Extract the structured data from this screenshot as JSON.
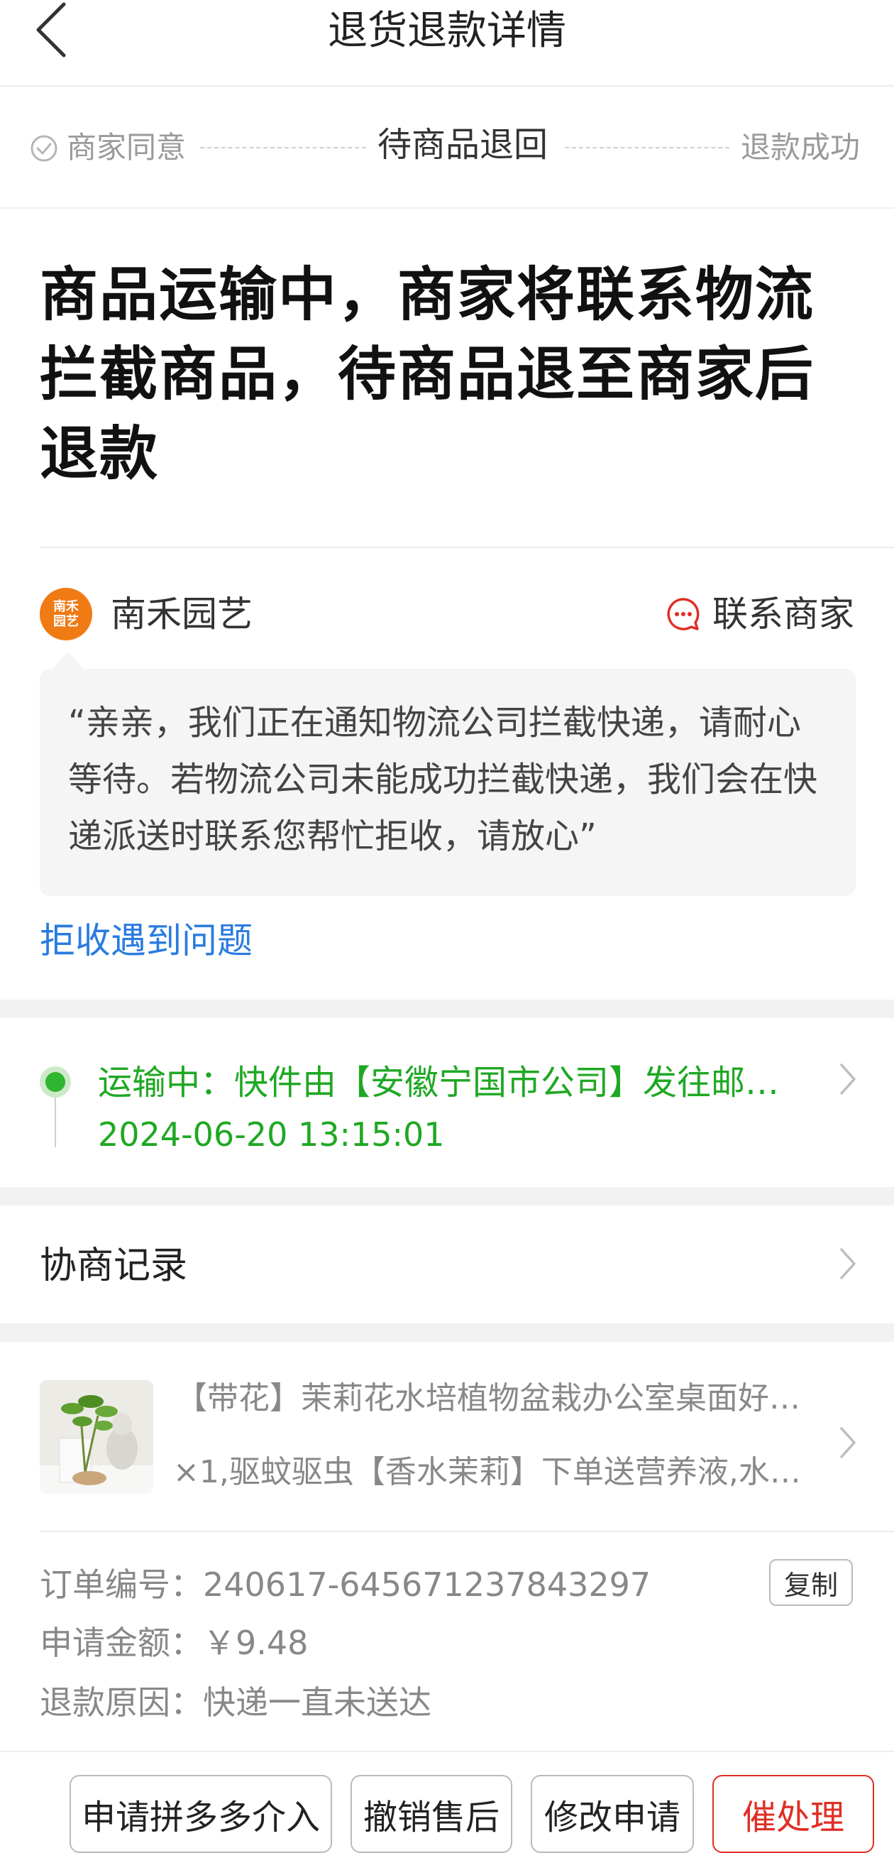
{
  "header": {
    "title": "退货退款详情"
  },
  "steps": [
    {
      "label": "商家同意",
      "state": "done"
    },
    {
      "label": "待商品退回",
      "state": "active"
    },
    {
      "label": "退款成功",
      "state": "pending"
    }
  ],
  "headline": "商品运输中，商家将联系物流拦截商品，待商品退至商家后退款",
  "shop": {
    "logo_text": "南禾\n园艺",
    "name": "南禾园艺",
    "contact_label": "联系商家"
  },
  "message": "“亲亲，我们正在通知物流公司拦截快递，请耐心等待。若物流公司未能成功拦截快递，我们会在快递派送时联系您帮忙拒收，请放心”",
  "reject_issue_link": "拒收遇到问题",
  "logistics": {
    "status": "运输中：快件由【安徽宁国市公司】发往邮…",
    "time": "2024-06-20 13:15:01"
  },
  "negotiation": {
    "label": "协商记录"
  },
  "product": {
    "title": "【带花】茉莉花水培植物盆栽办公室桌面好…",
    "spec": "×1,驱蚊驱虫【香水茉莉】下单送营养液,水养…"
  },
  "order": {
    "number_label": "订单编号：",
    "number": "240617-645671237843297",
    "copy_label": "复制",
    "amount_label": "申请金额：",
    "amount": "￥9.48",
    "reason_label": "退款原因：",
    "reason": "快递一直未送达"
  },
  "actions": [
    {
      "label": "申请拼多多介入"
    },
    {
      "label": "撤销售后"
    },
    {
      "label": "修改申请"
    },
    {
      "label": "催处理"
    }
  ],
  "colors": {
    "accent_red": "#e02e24",
    "link_blue": "#2a7be0",
    "logistics_green": "#1fa823",
    "shop_logo": "#f07a14"
  }
}
